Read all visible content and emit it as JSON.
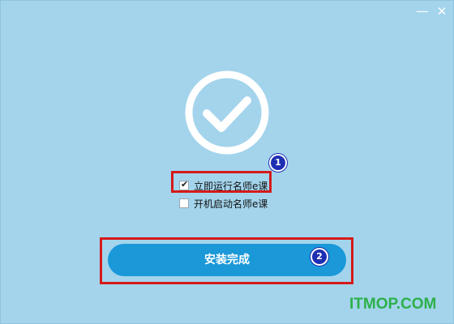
{
  "window": {
    "minimize_glyph": "—",
    "close_glyph": "✕",
    "background": "#a3d4ec"
  },
  "status": {
    "icon": "check-circle-icon",
    "color": "#ffffff"
  },
  "options": [
    {
      "label": "立即运行名师e课",
      "checked": true
    },
    {
      "label": "开机启动名师e课",
      "checked": false
    }
  ],
  "annotations": {
    "badge1": "1",
    "badge2": "2",
    "highlight_color": "#d51a1a",
    "badge_color": "#1d2fb2"
  },
  "finish_button": {
    "label": "安装完成",
    "color": "#1a98d8"
  },
  "watermark": {
    "text": "ITMOP.COM",
    "color": "#2db04b"
  }
}
